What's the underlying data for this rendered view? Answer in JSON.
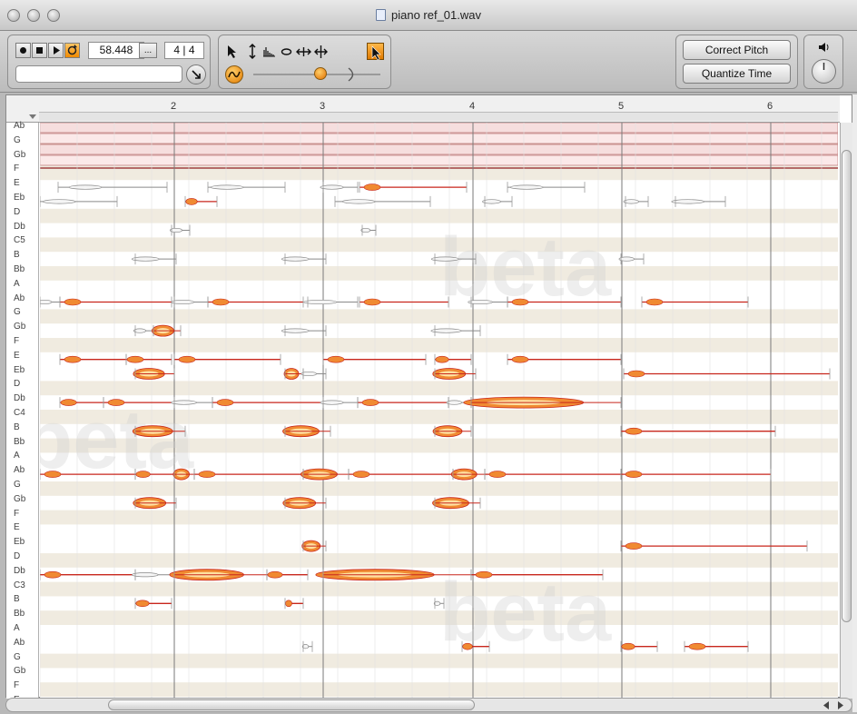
{
  "window": {
    "title": "piano ref_01.wav"
  },
  "transport": {
    "time": "58.448",
    "more_label": "...",
    "meter": "4 | 4",
    "record_icon": "record-icon",
    "stop_icon": "stop-icon",
    "play_icon": "play-icon",
    "loop_icon": "loop-icon"
  },
  "tools": {
    "items": [
      "arrow-tool-icon",
      "pitch-tool-icon",
      "amplitude-tool-icon",
      "formant-tool-icon",
      "time-tool-icon",
      "separation-tool-icon"
    ],
    "active_tool_icon": "pointer-active-icon",
    "scroll_follow_icon": "scroll-follow-icon"
  },
  "actions": {
    "correct_pitch": "Correct Pitch",
    "quantize_time": "Quantize Time"
  },
  "volume": {
    "speaker_icon": "speaker-icon",
    "knob_icon": "volume-knob-icon"
  },
  "ruler": {
    "bars": [
      "2",
      "3",
      "4",
      "5",
      "6"
    ]
  },
  "pitches": [
    "Ab",
    "G",
    "Gb",
    "F",
    "E",
    "Eb",
    "D",
    "Db",
    "C5",
    "B",
    "Bb",
    "A",
    "Ab",
    "G",
    "Gb",
    "F",
    "E",
    "Eb",
    "D",
    "Db",
    "C4",
    "B",
    "Bb",
    "A",
    "Ab",
    "G",
    "Gb",
    "F",
    "E",
    "Eb",
    "D",
    "Db",
    "C3",
    "B",
    "Bb",
    "A",
    "Ab",
    "G",
    "Gb",
    "F",
    "E"
  ],
  "watermark": "beta",
  "colors": {
    "note_red": "#c8261c",
    "note_orange": "#f08a32",
    "note_yellow": "#ffe0a0",
    "stripe": "#f0ebe0",
    "active_tool": "#f5a623"
  }
}
